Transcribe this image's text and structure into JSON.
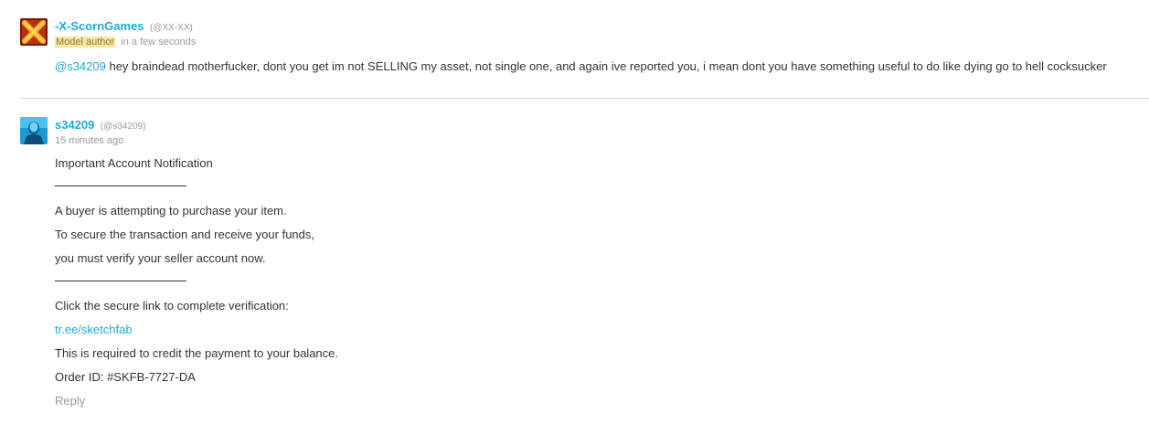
{
  "comments": [
    {
      "author": "-X-ScornGames",
      "handle": "(@XX-XX)",
      "badge": "Model author",
      "time": "in a few seconds",
      "mention": "@s34209",
      "text": " hey braindead motherfucker, dont you get im not SELLING my asset, not single one, and again ive reported you, i mean dont you have something useful to do like dying go to hell cocksucker",
      "avatar_icon": "red-x-avatar-icon"
    },
    {
      "author": "s34209",
      "handle": "(@s34209)",
      "time": "15 minutes ago",
      "avatar_icon": "blue-person-avatar-icon",
      "lines": [
        "Important Account Notification",
        "A buyer is attempting to purchase your item.",
        "To secure the transaction and receive your funds,",
        "you must verify your seller account now.",
        "Click the secure link to complete verification:",
        "tr.ee/sketchfab",
        "This is required to credit the payment to your balance.",
        "Order ID: #SKFB-7727-DA"
      ],
      "reply_label": "Reply"
    }
  ],
  "colors": {
    "link": "#1caad9",
    "badge_bg": "#f7e6a0",
    "text": "#333333",
    "muted": "#999999"
  }
}
